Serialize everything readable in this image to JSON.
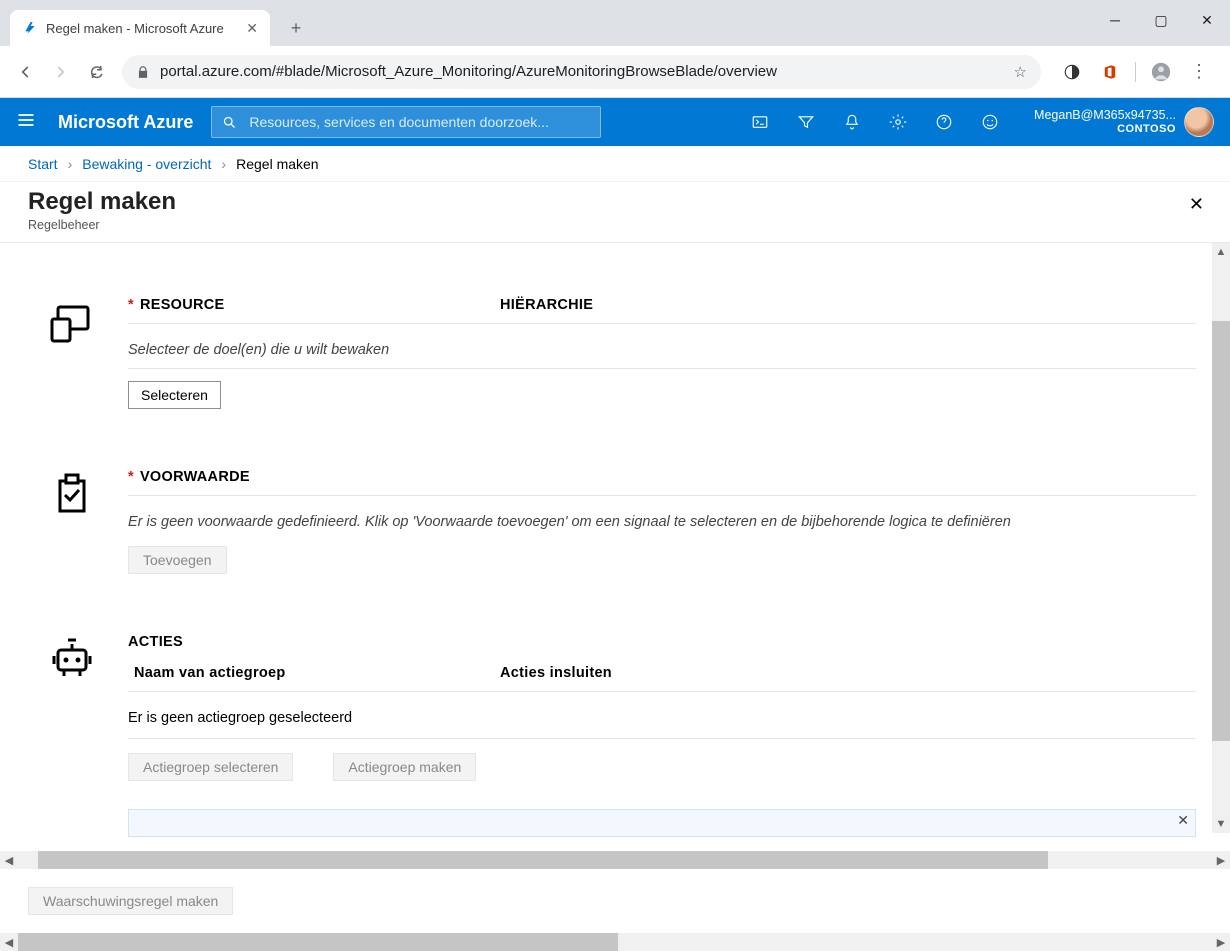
{
  "browser": {
    "tab_title": "Regel maken - Microsoft Azure",
    "url": "portal.azure.com/#blade/Microsoft_Azure_Monitoring/AzureMonitoringBrowseBlade/overview"
  },
  "azure": {
    "brand": "Microsoft Azure",
    "search_placeholder": "Resources, services en documenten doorzoek...",
    "account_name": "MeganB@M365x94735...",
    "tenant": "CONTOSO"
  },
  "breadcrumb": {
    "start": "Start",
    "monitor": "Bewaking - overzicht",
    "current": "Regel maken"
  },
  "blade": {
    "title": "Regel maken",
    "subtitle": "Regelbeheer"
  },
  "resource_section": {
    "header": "RESOURCE",
    "hierarchy_header": "HIËRARCHIE",
    "description": "Selecteer de doel(en) die u wilt bewaken",
    "select_button": "Selecteren"
  },
  "condition_section": {
    "header": "VOORWAARDE",
    "description": "Er is geen voorwaarde gedefinieerd. Klik op 'Voorwaarde toevoegen' om een signaal te selecteren en de bijbehorende logica te definiëren",
    "add_button": "Toevoegen"
  },
  "actions_section": {
    "header": "ACTIES",
    "col1": "Naam van actiegroep",
    "col2": "Acties insluiten",
    "empty": "Er is geen actiegroep geselecteerd",
    "select_btn": "Actiegroep selecteren",
    "create_btn": "Actiegroep maken"
  },
  "footer": {
    "create_rule": "Waarschuwingsregel maken"
  }
}
